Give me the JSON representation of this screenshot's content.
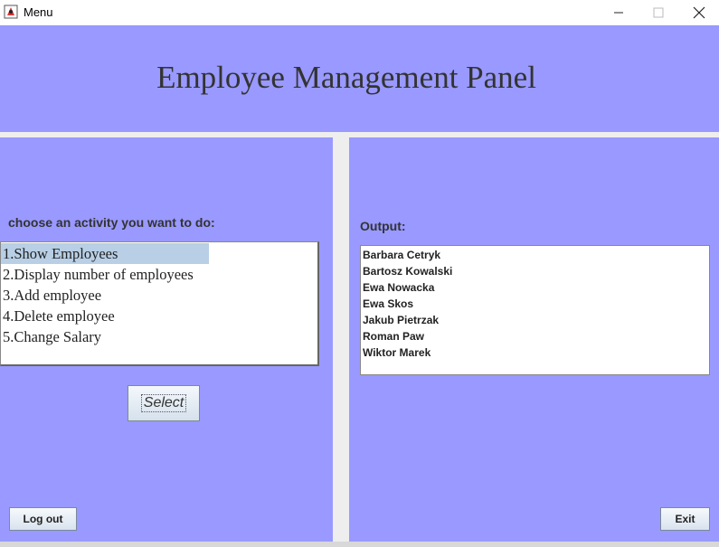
{
  "window": {
    "title": "Menu",
    "app_icon": "java-duke-icon",
    "controls": [
      "minimize-icon",
      "maximize-icon",
      "close-icon"
    ]
  },
  "header": {
    "title": "Employee Management Panel"
  },
  "left": {
    "prompt": "choose an activity you want to do:",
    "menu_items": [
      {
        "label": "1.Show Employees",
        "selected": true
      },
      {
        "label": "2.Display number of employees",
        "selected": false
      },
      {
        "label": "3.Add employee",
        "selected": false
      },
      {
        "label": "4.Delete employee",
        "selected": false
      },
      {
        "label": "5.Change Salary",
        "selected": false
      }
    ],
    "select_label": "Select",
    "logout_label": "Log out"
  },
  "right": {
    "output_label": "Output:",
    "output_lines": [
      "Barbara Cetryk",
      "Bartosz Kowalski",
      "Ewa Nowacka",
      "Ewa Skos",
      "Jakub Pietrzak",
      "Roman Paw",
      "Wiktor Marek"
    ],
    "exit_label": "Exit"
  },
  "colors": {
    "panel_bg": "#9999ff",
    "selection": "#b8cfe5",
    "text": "#333333"
  }
}
